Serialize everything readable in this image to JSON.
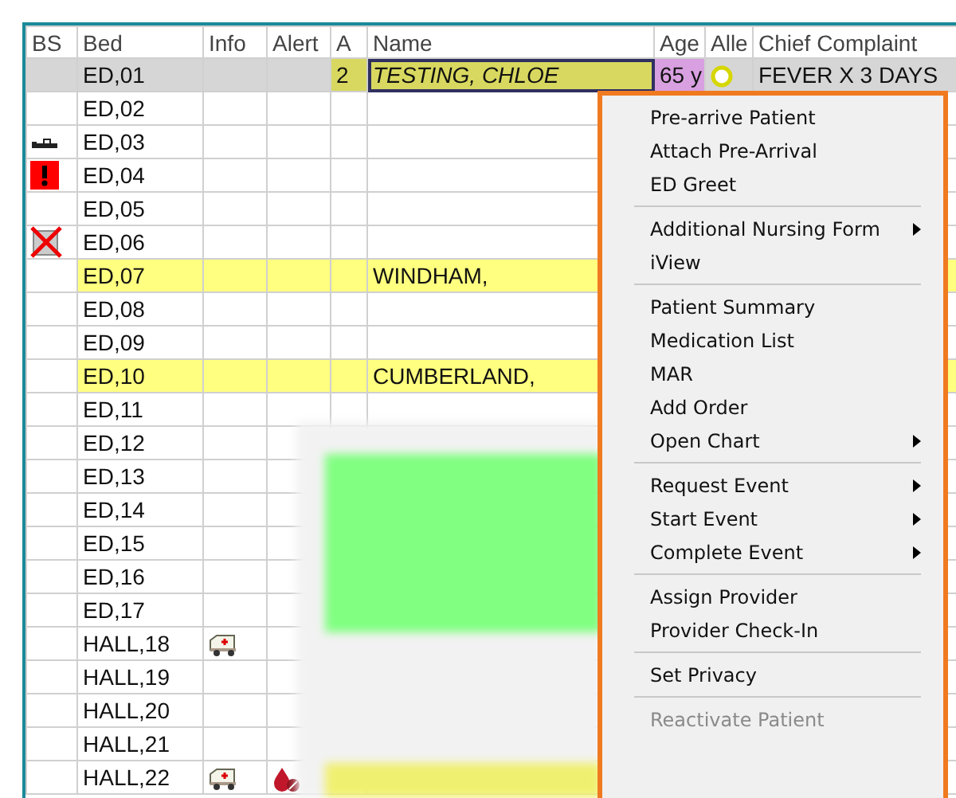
{
  "table": {
    "columns": [
      "BS",
      "Bed",
      "Info",
      "Alert",
      "A",
      "Name",
      "Age",
      "Alle",
      "Chief Complaint"
    ],
    "rows": [
      {
        "bed": "ED,01",
        "selected": true,
        "highlighted": false,
        "acuity": "2",
        "name": "TESTING, CHLOE",
        "age": "65 y",
        "allergy_icon": {
          "kind": "ring"
        },
        "complaint": "FEVER X 3 DAYS"
      },
      {
        "bed": "ED,02",
        "selected": false,
        "highlighted": false
      },
      {
        "bed": "ED,03",
        "selected": false,
        "highlighted": false,
        "bs_icon": {
          "kind": "bed"
        }
      },
      {
        "bed": "ED,04",
        "selected": false,
        "highlighted": false,
        "bs_icon": {
          "kind": "alert"
        }
      },
      {
        "bed": "ED,05",
        "selected": false,
        "highlighted": false
      },
      {
        "bed": "ED,06",
        "selected": false,
        "highlighted": false,
        "bs_icon": {
          "kind": "blocked"
        }
      },
      {
        "bed": "ED,07",
        "selected": false,
        "highlighted": true,
        "name": "WINDHAM,"
      },
      {
        "bed": "ED,08",
        "selected": false,
        "highlighted": false
      },
      {
        "bed": "ED,09",
        "selected": false,
        "highlighted": false
      },
      {
        "bed": "ED,10",
        "selected": false,
        "highlighted": true,
        "name": "CUMBERLAND,"
      },
      {
        "bed": "ED,11",
        "selected": false,
        "highlighted": false
      },
      {
        "bed": "ED,12",
        "selected": false,
        "highlighted": false
      },
      {
        "bed": "ED,13",
        "selected": false,
        "highlighted": false
      },
      {
        "bed": "ED,14",
        "selected": false,
        "highlighted": false
      },
      {
        "bed": "ED,15",
        "selected": false,
        "highlighted": false
      },
      {
        "bed": "ED,16",
        "selected": false,
        "highlighted": false
      },
      {
        "bed": "ED,17",
        "selected": false,
        "highlighted": false
      },
      {
        "bed": "HALL,18",
        "selected": false,
        "highlighted": false,
        "info_icon": {
          "kind": "ambulance"
        }
      },
      {
        "bed": "HALL,19",
        "selected": false,
        "highlighted": false
      },
      {
        "bed": "HALL,20",
        "selected": false,
        "highlighted": false
      },
      {
        "bed": "HALL,21",
        "selected": false,
        "highlighted": false
      },
      {
        "bed": "HALL,22",
        "selected": false,
        "highlighted": false,
        "info_icon": {
          "kind": "ambulance"
        },
        "alert_icon": {
          "kind": "blood"
        }
      }
    ]
  },
  "context_menu": {
    "groups": [
      [
        {
          "label": "Pre-arrive Patient",
          "submenu": false,
          "disabled": false
        },
        {
          "label": "Attach Pre-Arrival",
          "submenu": false,
          "disabled": false
        },
        {
          "label": "ED Greet",
          "submenu": false,
          "disabled": false
        }
      ],
      [
        {
          "label": "Additional Nursing Form",
          "submenu": true,
          "disabled": false
        },
        {
          "label": "iView",
          "submenu": false,
          "disabled": false
        }
      ],
      [
        {
          "label": "Patient Summary",
          "submenu": false,
          "disabled": false
        },
        {
          "label": "Medication List",
          "submenu": false,
          "disabled": false
        },
        {
          "label": "MAR",
          "submenu": false,
          "disabled": false
        },
        {
          "label": "Add Order",
          "submenu": false,
          "disabled": false
        },
        {
          "label": "Open Chart",
          "submenu": true,
          "disabled": false
        }
      ],
      [
        {
          "label": "Request Event",
          "submenu": true,
          "disabled": false
        },
        {
          "label": "Start Event",
          "submenu": true,
          "disabled": false
        },
        {
          "label": "Complete Event",
          "submenu": true,
          "disabled": false
        }
      ],
      [
        {
          "label": "Assign Provider",
          "submenu": false,
          "disabled": false
        },
        {
          "label": "Provider Check-In",
          "submenu": false,
          "disabled": false
        }
      ],
      [
        {
          "label": "Set Privacy",
          "submenu": false,
          "disabled": false
        }
      ],
      [
        {
          "label": "Reactivate Patient",
          "submenu": false,
          "disabled": true
        }
      ]
    ]
  }
}
